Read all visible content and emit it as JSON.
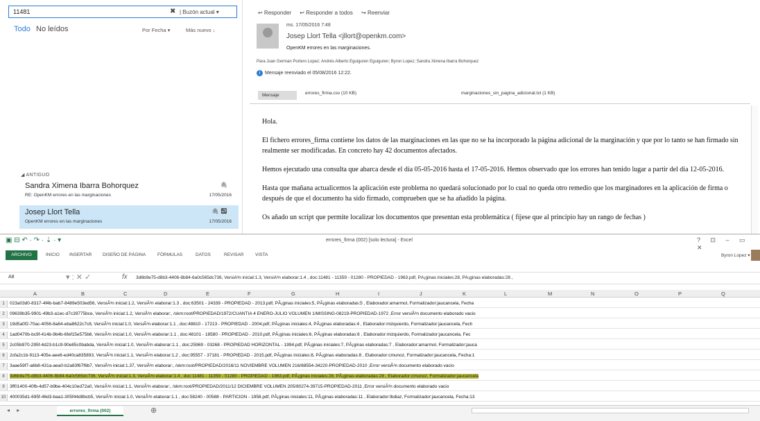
{
  "outlook": {
    "search_value": "11481",
    "search_clear": "✖",
    "search_scope": "| Buzón actual ▾",
    "tab_all": "Todo",
    "tab_unread": "No leídos",
    "sort_by": "Por Fecha ▾",
    "order": "Más nuevo ↓",
    "group_label": "◢ ANTIGUO",
    "mails": [
      {
        "from": "Sandra Ximena Ibarra Bohorquez",
        "subject": "RE: OpenKM errores en las marginaciones",
        "date": "17/05/2016",
        "icon": "🖇"
      },
      {
        "from": "Josep Llort Tella",
        "subject": "OpenKM errores en las marginaciones",
        "date": "17/05/2016",
        "icon": "🖇 ↩"
      }
    ],
    "actions": [
      "↩ Responder",
      "↩ Responder a todos",
      "↪ Reenviar"
    ],
    "message": {
      "date": "ms. 17/05/2016 7:48",
      "sender": "Josep Llort Tella <jllort@openkm.com>",
      "subject": "OpenKM errores en las marginaciones.",
      "to": "Para   Juan German Portero Lopez; Andrés Alberto Eguiguren Eguiguren; Byron Lopez; Sandra Ximena Ibarra Bohorquez",
      "forwarded": "Mensaje reenviado el 05/08/2016 12:22.",
      "attachments": [
        "Mensaje",
        "errores_firma.csv (10 KB)",
        "marginaciones_sin_pagina_adicional.txt (1 KB)"
      ],
      "body": [
        "Hola.",
        "El fichero errores_firma contiene los datos de las marginaciones en las que no se ha incorporado la página adicional de la marginación y que por lo tanto se han firmado sin realmente ser modificadas. En concreto hay 42 documentos afectados.",
        "Hemos ejecutado una consulta que abarca desde el día 05-05-2016 hasta el 17-05-2016. Hemos observado que los errores  han tenido lugar a partir del día 12-05-2016.",
        "Hasta que mañana actualicemos la aplicación este problema no quedará solucionado por lo cual no queda otro remedio que los marginadores en la aplicación de firma o después de que el documento ha sido firmado, comprueben que se ha añadido la página.",
        "Os añado un script que permite localizar los documentos que presentan esta problemática ( fíjese que al principio hay un rango de fechas )"
      ]
    }
  },
  "excel": {
    "qat": "▣ ⊟ ↶ · ↷ · ⇣ · ▾",
    "title": "errores_firma (002)  [solo lectura] - Excel",
    "window_controls": "? ⊡ – ▭ ✕",
    "archivo": "ARCHIVO",
    "tabs": [
      "INICIO",
      "INSERTAR",
      "DISEÑO DE PÁGINA",
      "FÓRMULAS",
      "DATOS",
      "REVISAR",
      "VISTA"
    ],
    "user": "Byron Lopez ▾",
    "namebox": "A8",
    "fx_icons": "▾  :  ✕  ✓",
    "fx": "fx",
    "formula": "3d6b9e75-d8b3-4406-8b84-6a0c565dc736, VersiÃ³n inicial:1.3, VersiÃ³n elaborar:1.4 , doc:11481 - 11359 - 01280 - PROPIEDAD - 1963.pdf, PÃ¡ginas iniciales:28, PÃ¡ginas elaboradas:28 ,",
    "columns": [
      "A",
      "B",
      "C",
      "D",
      "E",
      "F",
      "G",
      "H",
      "I",
      "J",
      "K",
      "L",
      "M",
      "N",
      "O",
      "P",
      "Q"
    ],
    "rows": [
      {
        "n": "1",
        "text": "023a03d0-8317-4f4b-bab7-8489e503ed56, VersiÃ³n inicial:1.2, VersiÃ³n elaborar:1.3 , doc:63501 - 24339 - PROPIEDAD - 2013.pdf, PÃ¡ginas iniciales:5, PÃ¡ginas elaboradas:5 , Elaborador:amarmol, Formalizador:jaucancela, Fecha"
      },
      {
        "n": "2",
        "text": "09639b35-9901-49b3-a1ec-d7c39775bce, VersiÃ³n inicial:1.2, VersiÃ³n elaborar:, /okm:root/PROPIEDAD/1972/CUANTIA 4 ENERO-JULIO VOLUMEN 1/MISSING-08219-PROPIEDAD-1972 ,Error versiÃ³n documento elaborado vacio"
      },
      {
        "n": "3",
        "text": "19d5a0f2-70ac-4056-8a64-eba8622c7c8, VersiÃ³n inicial:1.0, VersiÃ³n elaborar:1.1 , doc:48810 - 17213 - PROPIEDAD - 2004.pdf, PÃ¡ginas iniciales:4, PÃ¡ginas elaboradas:4 , Elaborador:mizquierdo, Formalizador:jaucancela, Fech"
      },
      {
        "n": "4",
        "text": "1ad0470b-bc9f-414b-9b4b-6fef15e575b6, VersiÃ³n inicial:1.0, VersiÃ³n elaborar:1.1 , doc:48101 - 18580 - PROPIEDAD - 2010.pdf, PÃ¡ginas iniciales:6, PÃ¡ginas elaboradas:6 , Elaborador:mizquierdo, Formalizador:jaucancela, Fec"
      },
      {
        "n": "5",
        "text": "2c05b970-295f-4d23-b1c9-90e85c0babda, VersiÃ³n inicial:1.0, VersiÃ³n elaborar:1.1 , doc:25969 - 03268 - PROPIEDAD HORIZONTAL - 1994.pdf, PÃ¡ginas iniciales:7, PÃ¡ginas elaboradas:7 , Elaborador:amarmol, Formalizador:jauca"
      },
      {
        "n": "6",
        "text": "2cfa2c1b-9113-405e-aee6-ed40ca835893, VersiÃ³n inicial:1.1, VersiÃ³n elaborar:1.2 , doc:95557 - 37181 - PROPIEDAD - 2015.pdf, PÃ¡ginas iniciales:8, PÃ¡ginas elaboradas:8 , Elaborador:cmunoz, Formalizador:jaucancela, Fecha:1"
      },
      {
        "n": "7",
        "text": "3aae59f7-a6b8-431a-aea0-b2a83f67f6b7, VersiÃ³n inicial:1.37, VersiÃ³n elaborar:, /okm:root/PROPIEDAD/2016/11 NOVIEMBRE VOLUMEN 216/88554-34220-PROPIEDAD-2010 ,Error versiÃ³n documento elaborado vacio"
      },
      {
        "n": "8",
        "text": "3d6b9e75-d8b3-4406-8b84-6a0c565dc736, VersiÃ³n inicial:1.3, VersiÃ³n elaborar:1.4 , doc:11481 - 11359 - 01280 - PROPIEDAD - 1963.pdf, PÃ¡ginas iniciales:28, PÃ¡ginas elaboradas:28 , Elaborador:cmunoz, Formalizador:jaucancela",
        "selected": true
      },
      {
        "n": "9",
        "text": "3ff01400-40fb-4d57-b9be-404c10ed72a0, VersiÃ³n inicial:1.1, VersiÃ³n elaborar:, /okm:root/PROPIEDAD/2011/12 DICIEMBRE VOLUMEN 205/80274-39715-PROPIEDAD-2011 ,Error versiÃ³n documento elaborado vacio"
      },
      {
        "n": "10",
        "text": "400035d1-695f-46d3-baa1-305f44d8bcb5, VersiÃ³n inicial:1.0, VersiÃ³n elaborar:1.1 , doc:58240 - 00588 - PARTICION - 1958.pdf, PÃ¡ginas iniciales:11, PÃ¡ginas elaboradas:11 , Elaborador:lbdiaz, Formalizador:jaucancela, Fecha:13"
      }
    ],
    "sheet_nav": "◂ ▸",
    "sheet_tab": "errores_firma (002)",
    "add_sheet": "⊕"
  }
}
